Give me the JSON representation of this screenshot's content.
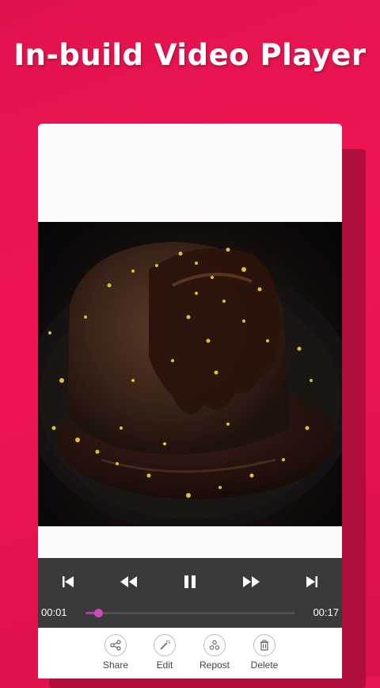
{
  "headline": "In-build Video Player",
  "player": {
    "current_time": "00:01",
    "duration": "00:17",
    "progress": 0.06,
    "accent_color": "#b23fa6",
    "buttons": [
      {
        "name": "skip-previous",
        "icon": "skip-previous-icon"
      },
      {
        "name": "rewind",
        "icon": "rewind-icon"
      },
      {
        "name": "pause",
        "icon": "pause-icon"
      },
      {
        "name": "fast-forward",
        "icon": "fast-forward-icon"
      },
      {
        "name": "skip-next",
        "icon": "skip-next-icon"
      }
    ]
  },
  "actions": [
    {
      "label": "Share",
      "icon": "share-icon"
    },
    {
      "label": "Edit",
      "icon": "magic-wand-icon"
    },
    {
      "label": "Repost",
      "icon": "repost-icon"
    },
    {
      "label": "Delete",
      "icon": "trash-icon"
    }
  ],
  "colors": {
    "background": "#f01552",
    "controls_bar": "#3a3a3a"
  }
}
